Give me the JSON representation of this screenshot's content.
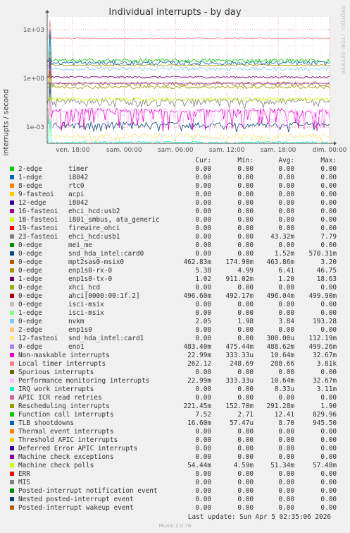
{
  "title": "Individual interrupts - by day",
  "ylabel": "interrupts / second",
  "side_label": "RRDTOOL / TOBI OETIKER",
  "header": {
    "cur": "Cur:",
    "min": "Min:",
    "avg": "Avg:",
    "max": "Max:"
  },
  "last_update": "Last update: Sun Apr  5 02:35:06 2026",
  "footer": "Munin 2.0.76",
  "chart_data": {
    "type": "line",
    "title": "Individual interrupts - by day",
    "ylabel": "interrupts / second",
    "yscale": "log",
    "ylim": [
      0.0001,
      6000
    ],
    "yticks": [
      {
        "v": 0.001,
        "label": "1e-03"
      },
      {
        "v": 1,
        "label": "1e+00"
      },
      {
        "v": 1000,
        "label": "1e+03"
      }
    ],
    "xlim": [
      0,
      33
    ],
    "xticks": [
      {
        "v": 3,
        "label": "ven. 18:00"
      },
      {
        "v": 9,
        "label": "sam. 00:00"
      },
      {
        "v": 15,
        "label": "sam. 06:00"
      },
      {
        "v": 21,
        "label": "sam. 12:00"
      },
      {
        "v": 27,
        "label": "sam. 18:00"
      },
      {
        "v": 33,
        "label": "dim. 00:00"
      }
    ],
    "grid": true,
    "series": [
      {
        "name": "timer",
        "irq": "2-edge",
        "color": "#00cc00",
        "cur": "0.00",
        "min": "0.00",
        "avg": "0.00",
        "max": "0.00"
      },
      {
        "name": "i8042",
        "irq": "1-edge",
        "color": "#0066b3",
        "cur": "0.00",
        "min": "0.00",
        "avg": "0.00",
        "max": "0.00"
      },
      {
        "name": "rtc0",
        "irq": "8-edge",
        "color": "#ff8000",
        "cur": "0.00",
        "min": "0.00",
        "avg": "0.00",
        "max": "0.00"
      },
      {
        "name": "acpi",
        "irq": "9-fasteoi",
        "color": "#ffcc00",
        "cur": "0.00",
        "min": "0.00",
        "avg": "0.00",
        "max": "0.00"
      },
      {
        "name": "i8042",
        "irq": "12-edge",
        "color": "#330099",
        "cur": "0.00",
        "min": "0.00",
        "avg": "0.00",
        "max": "0.00"
      },
      {
        "name": "ehci_hcd:usb2",
        "irq": "16-fasteoi",
        "color": "#990099",
        "cur": "0.00",
        "min": "0.00",
        "avg": "0.00",
        "max": "0.00"
      },
      {
        "name": "i801_smbus, ata_generic",
        "irq": "18-fasteoi",
        "color": "#ccff00",
        "cur": "0.00",
        "min": "0.00",
        "avg": "0.00",
        "max": "0.00"
      },
      {
        "name": "firewire_ohci",
        "irq": "19-fasteoi",
        "color": "#ff0000",
        "cur": "0.00",
        "min": "0.00",
        "avg": "0.00",
        "max": "0.00"
      },
      {
        "name": "ehci_hcd:usb1",
        "irq": "23-fasteoi",
        "color": "#808080",
        "cur": "0.00",
        "min": "0.00",
        "avg": "43.32m",
        "max": "7.79"
      },
      {
        "name": "mei_me",
        "irq": "0-edge",
        "color": "#008f00",
        "cur": "0.00",
        "min": "0.00",
        "avg": "0.00",
        "max": "0.00"
      },
      {
        "name": "snd_hda_intel:card0",
        "irq": "0-edge",
        "color": "#00487d",
        "cur": "0.00",
        "min": "0.00",
        "avg": "1.52m",
        "max": "570.31m"
      },
      {
        "name": "mpt2sas0-msix0",
        "irq": "0-edge",
        "color": "#b35a00",
        "cur": "462.83m",
        "min": "174.90m",
        "avg": "463.86m",
        "max": "3.20"
      },
      {
        "name": "enp1s0-rx-0",
        "irq": "0-edge",
        "color": "#b38f00",
        "cur": "5.38",
        "min": "4.99",
        "avg": "6.41",
        "max": "46.75"
      },
      {
        "name": "enp1s0-tx-0",
        "irq": "1-edge",
        "color": "#6b006b",
        "cur": "1.02",
        "min": "911.02m",
        "avg": "1.20",
        "max": "18.63"
      },
      {
        "name": "xhci_hcd",
        "irq": "0-edge",
        "color": "#8fb300",
        "cur": "0.00",
        "min": "0.00",
        "avg": "0.00",
        "max": "0.00"
      },
      {
        "name": "ahci[0000:00:1f.2]",
        "irq": "0-edge",
        "color": "#b30000",
        "cur": "496.60m",
        "min": "492.17m",
        "avg": "496.04m",
        "max": "499.90m"
      },
      {
        "name": "isci-msix",
        "irq": "0-edge",
        "color": "#bebebe",
        "cur": "0.00",
        "min": "0.00",
        "avg": "0.00",
        "max": "0.00"
      },
      {
        "name": "isci-msix",
        "irq": "1-edge",
        "color": "#80ff80",
        "cur": "0.00",
        "min": "0.00",
        "avg": "0.00",
        "max": "0.00"
      },
      {
        "name": "nvkm",
        "irq": "0-edge",
        "color": "#80c9ff",
        "cur": "2.05",
        "min": "1.98",
        "avg": "3.84",
        "max": "193.28"
      },
      {
        "name": "enp1s0",
        "irq": "2-edge",
        "color": "#ffc080",
        "cur": "0.00",
        "min": "0.00",
        "avg": "0.00",
        "max": "0.00"
      },
      {
        "name": "snd_hda_intel:card1",
        "irq": "12-fasteoi",
        "color": "#ffe680",
        "cur": "0.00",
        "min": "0.00",
        "avg": "300.00u",
        "max": "112.19m"
      },
      {
        "name": "eno1",
        "irq": "0-edge",
        "color": "#aa80ff",
        "cur": "483.40m",
        "min": "475.44m",
        "avg": "488.62m",
        "max": "499.26m"
      },
      {
        "name": "Non-maskable interrupts",
        "irq": "",
        "color": "#ee00cc",
        "cur": "22.99m",
        "min": "333.33u",
        "avg": "10.64m",
        "max": "32.67m"
      },
      {
        "name": "Local timer interrupts",
        "irq": "",
        "color": "#ff8080",
        "cur": "262.12",
        "min": "248.69",
        "avg": "288.66",
        "max": "3.81k"
      },
      {
        "name": "Spurious interrupts",
        "irq": "",
        "color": "#666600",
        "cur": "0.00",
        "min": "0.00",
        "avg": "0.00",
        "max": "0.00"
      },
      {
        "name": "Performance monitoring interrupts",
        "irq": "",
        "color": "#ffbfff",
        "cur": "22.99m",
        "min": "333.33u",
        "avg": "10.64m",
        "max": "32.67m"
      },
      {
        "name": "IRQ work interrupts",
        "irq": "",
        "color": "#00ffcc",
        "cur": "0.00",
        "min": "0.00",
        "avg": "8.33u",
        "max": "3.11m"
      },
      {
        "name": "APIC ICR read retries",
        "irq": "",
        "color": "#cc6699",
        "cur": "0.00",
        "min": "0.00",
        "avg": "0.00",
        "max": "0.00"
      },
      {
        "name": "Rescheduling interrupts",
        "irq": "",
        "color": "#999900",
        "cur": "221.45m",
        "min": "152.70m",
        "avg": "291.28m",
        "max": "1.90"
      },
      {
        "name": "Function call interrupts",
        "irq": "",
        "color": "#00cc00",
        "cur": "7.52",
        "min": "2.71",
        "avg": "12.41",
        "max": "829.96"
      },
      {
        "name": "TLB shootdowns",
        "irq": "",
        "color": "#0066b3",
        "cur": "16.60m",
        "min": "57.47u",
        "avg": "8.70",
        "max": "945.50"
      },
      {
        "name": "Thermal event interrupts",
        "irq": "",
        "color": "#ff8000",
        "cur": "0.00",
        "min": "0.00",
        "avg": "0.00",
        "max": "0.00"
      },
      {
        "name": "Threshold APIC interrupts",
        "irq": "",
        "color": "#ffcc00",
        "cur": "0.00",
        "min": "0.00",
        "avg": "0.00",
        "max": "0.00"
      },
      {
        "name": "Deferred Error APIC interrupts",
        "irq": "",
        "color": "#330099",
        "cur": "0.00",
        "min": "0.00",
        "avg": "0.00",
        "max": "0.00"
      },
      {
        "name": "Machine check exceptions",
        "irq": "",
        "color": "#990099",
        "cur": "0.00",
        "min": "0.00",
        "avg": "0.00",
        "max": "0.00"
      },
      {
        "name": "Machine check polls",
        "irq": "",
        "color": "#ccff00",
        "cur": "54.44m",
        "min": "4.59m",
        "avg": "51.34m",
        "max": "57.48m"
      },
      {
        "name": "ERR",
        "irq": "",
        "color": "#ff0000",
        "cur": "0.00",
        "min": "0.00",
        "avg": "0.00",
        "max": "0.00"
      },
      {
        "name": "MIS",
        "irq": "",
        "color": "#808080",
        "cur": "0.00",
        "min": "0.00",
        "avg": "0.00",
        "max": "0.00"
      },
      {
        "name": "Posted-interrupt notification event",
        "irq": "",
        "color": "#008f00",
        "cur": "0.00",
        "min": "0.00",
        "avg": "0.00",
        "max": "0.00"
      },
      {
        "name": "Nested posted-interrupt event",
        "irq": "",
        "color": "#00487d",
        "cur": "0.00",
        "min": "0.00",
        "avg": "0.00",
        "max": "0.00"
      },
      {
        "name": "Posted-interrupt wakeup event",
        "irq": "",
        "color": "#b35a00",
        "cur": "0.00",
        "min": "0.00",
        "avg": "0.00",
        "max": "0.00"
      }
    ]
  }
}
